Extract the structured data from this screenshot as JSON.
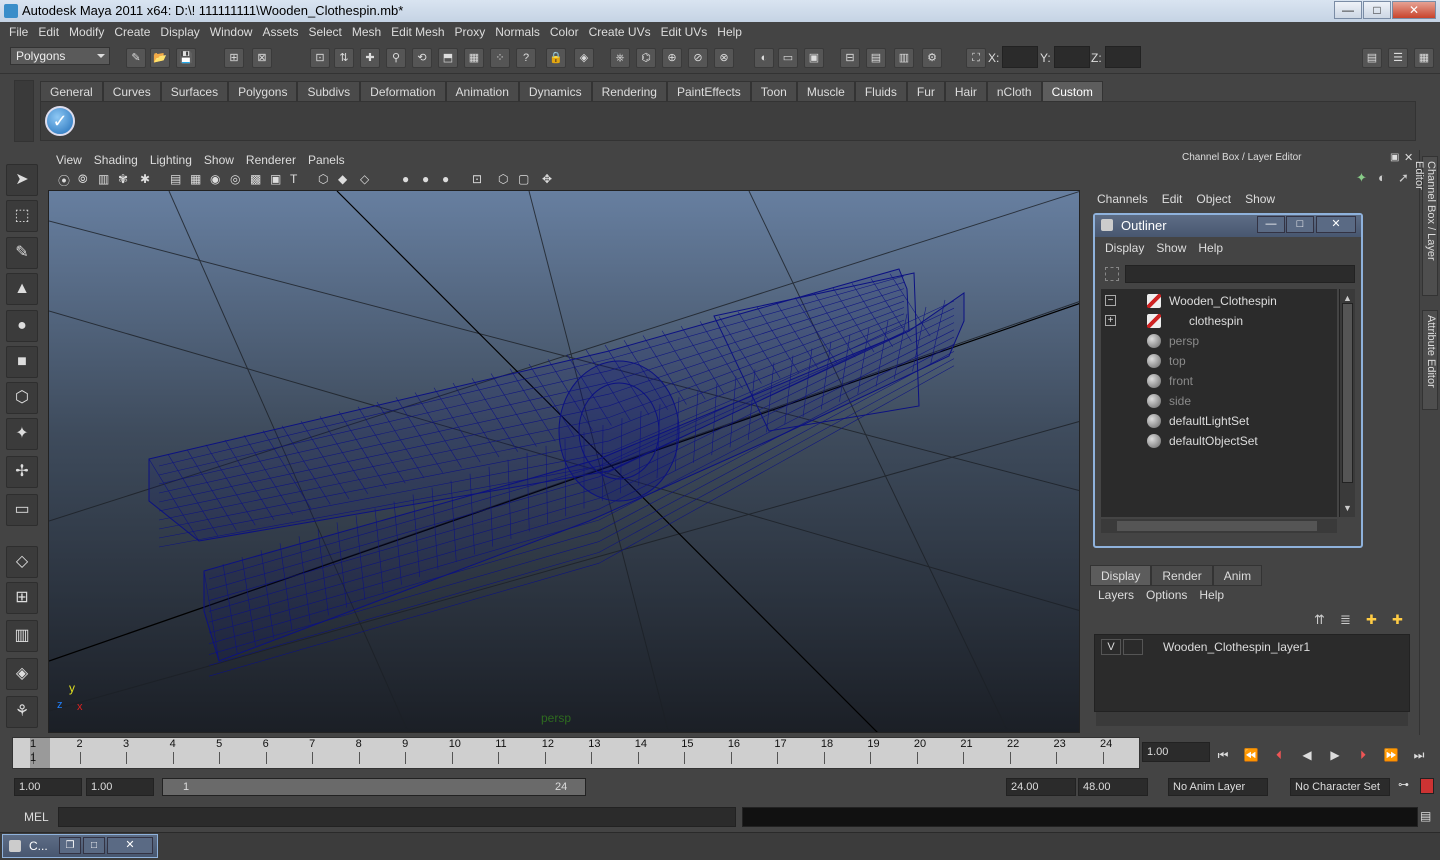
{
  "window": {
    "title": "Autodesk Maya 2011 x64: D:\\! 111111111\\Wooden_Clothespin.mb*",
    "min": "—",
    "max": "□",
    "close": "✕"
  },
  "menubar": [
    "File",
    "Edit",
    "Modify",
    "Create",
    "Display",
    "Window",
    "Assets",
    "Select",
    "Mesh",
    "Edit Mesh",
    "Proxy",
    "Normals",
    "Color",
    "Create UVs",
    "Edit UVs",
    "Help"
  ],
  "status": {
    "mode": "Polygons",
    "x_label": "X:",
    "y_label": "Y:",
    "z_label": "Z:"
  },
  "shelf": {
    "tabs": [
      "General",
      "Curves",
      "Surfaces",
      "Polygons",
      "Subdivs",
      "Deformation",
      "Animation",
      "Dynamics",
      "Rendering",
      "PaintEffects",
      "Toon",
      "Muscle",
      "Fluids",
      "Fur",
      "Hair",
      "nCloth",
      "Custom"
    ],
    "active": "Custom"
  },
  "viewport": {
    "menu": [
      "View",
      "Shading",
      "Lighting",
      "Show",
      "Renderer",
      "Panels"
    ],
    "camera_label": "persp",
    "axis_y": "y",
    "axis_x": "x",
    "axis_z": "z"
  },
  "channel_box": {
    "title": "Channel Box / Layer Editor",
    "menu": [
      "Channels",
      "Edit",
      "Object",
      "Show"
    ]
  },
  "outliner": {
    "title": "Outliner",
    "menu": [
      "Display",
      "Show",
      "Help"
    ],
    "items": [
      {
        "label": "Wooden_Clothespin",
        "expand": "−",
        "dim": false
      },
      {
        "label": "clothespin",
        "expand": "+",
        "dim": false
      },
      {
        "label": "persp",
        "dim": true
      },
      {
        "label": "top",
        "dim": true
      },
      {
        "label": "front",
        "dim": true
      },
      {
        "label": "side",
        "dim": true
      },
      {
        "label": "defaultLightSet",
        "dim": false
      },
      {
        "label": "defaultObjectSet",
        "dim": false
      }
    ]
  },
  "layer_editor": {
    "tabs": [
      "Display",
      "Render",
      "Anim"
    ],
    "active": "Display",
    "menu": [
      "Layers",
      "Options",
      "Help"
    ],
    "layers": [
      {
        "visible": "V",
        "name": "Wooden_Clothespin_layer1"
      }
    ]
  },
  "side_tabs": [
    "Channel Box / Layer Editor",
    "Attribute Editor"
  ],
  "timeline": {
    "ticks": [
      1,
      2,
      3,
      4,
      5,
      6,
      7,
      8,
      9,
      10,
      11,
      12,
      13,
      14,
      15,
      16,
      17,
      18,
      19,
      20,
      21,
      22,
      23,
      24
    ],
    "current": "1",
    "current_field": "1.00"
  },
  "range": {
    "start": "1.00",
    "start2": "1.00",
    "slider_start": "1",
    "slider_end": "24",
    "end": "24.00",
    "end2": "48.00",
    "anim_layer": "No Anim Layer",
    "char_set": "No Character Set"
  },
  "command": {
    "label": "MEL"
  },
  "taskbar": {
    "label": "C..."
  },
  "colors": {
    "wire": "#0c1182",
    "bg": "#444444"
  }
}
